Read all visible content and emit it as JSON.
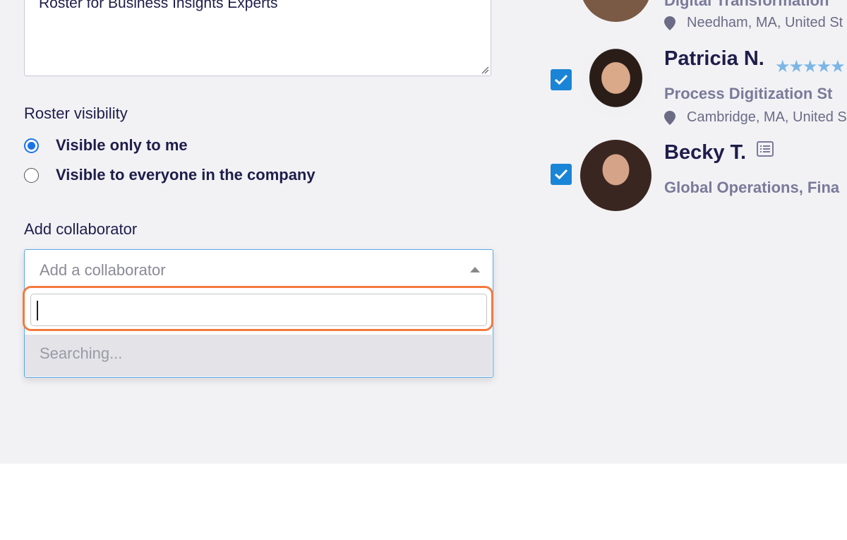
{
  "form": {
    "roster_name_value": "Roster for Business Insights Experts",
    "visibility_label": "Roster visibility",
    "visibility_options": [
      {
        "label": "Visible only to me",
        "selected": true
      },
      {
        "label": "Visible to everyone in the company",
        "selected": false
      }
    ],
    "collaborator_label": "Add collaborator",
    "collaborator_placeholder": "Add a collaborator",
    "search_value": "",
    "searching_text": "Searching..."
  },
  "roster": {
    "people": [
      {
        "name": "",
        "subtitle": "Digital Transformation",
        "location": "Needham, MA, United St",
        "checked": true
      },
      {
        "name": "Patricia N.",
        "subtitle": "Process Digitization St",
        "location": "Cambridge, MA, United S",
        "checked": true,
        "stars": "★★★★★"
      },
      {
        "name": "Becky T.",
        "subtitle": "Global Operations, Fina",
        "location": "",
        "checked": true
      }
    ]
  },
  "colors": {
    "accent_blue": "#1a73e8",
    "checkbox_blue": "#1a85d6",
    "highlight_orange": "#f47a3d",
    "panel_bg": "#f2f2f5",
    "text_dark": "#1e1d4a"
  }
}
